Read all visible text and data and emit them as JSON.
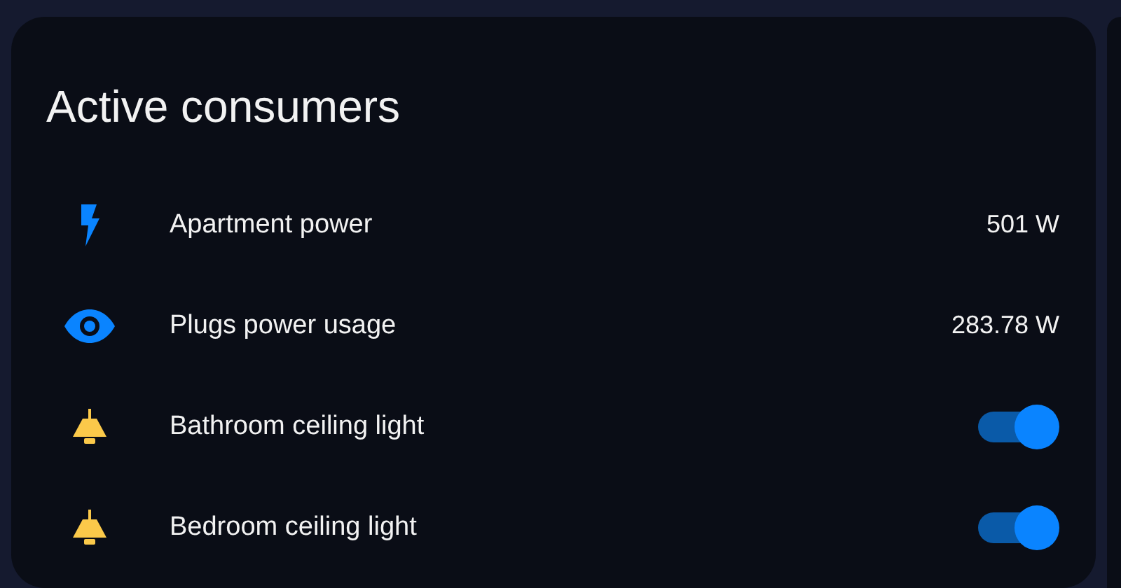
{
  "card": {
    "title": "Active consumers",
    "entities": [
      {
        "kind": "power",
        "name": "Apartment power",
        "value": "501 W"
      },
      {
        "kind": "usage",
        "name": "Plugs power usage",
        "value": "283.78 W"
      },
      {
        "kind": "light",
        "name": "Bathroom ceiling light",
        "on": true
      },
      {
        "kind": "light",
        "name": "Bedroom ceiling light",
        "on": true
      }
    ]
  }
}
